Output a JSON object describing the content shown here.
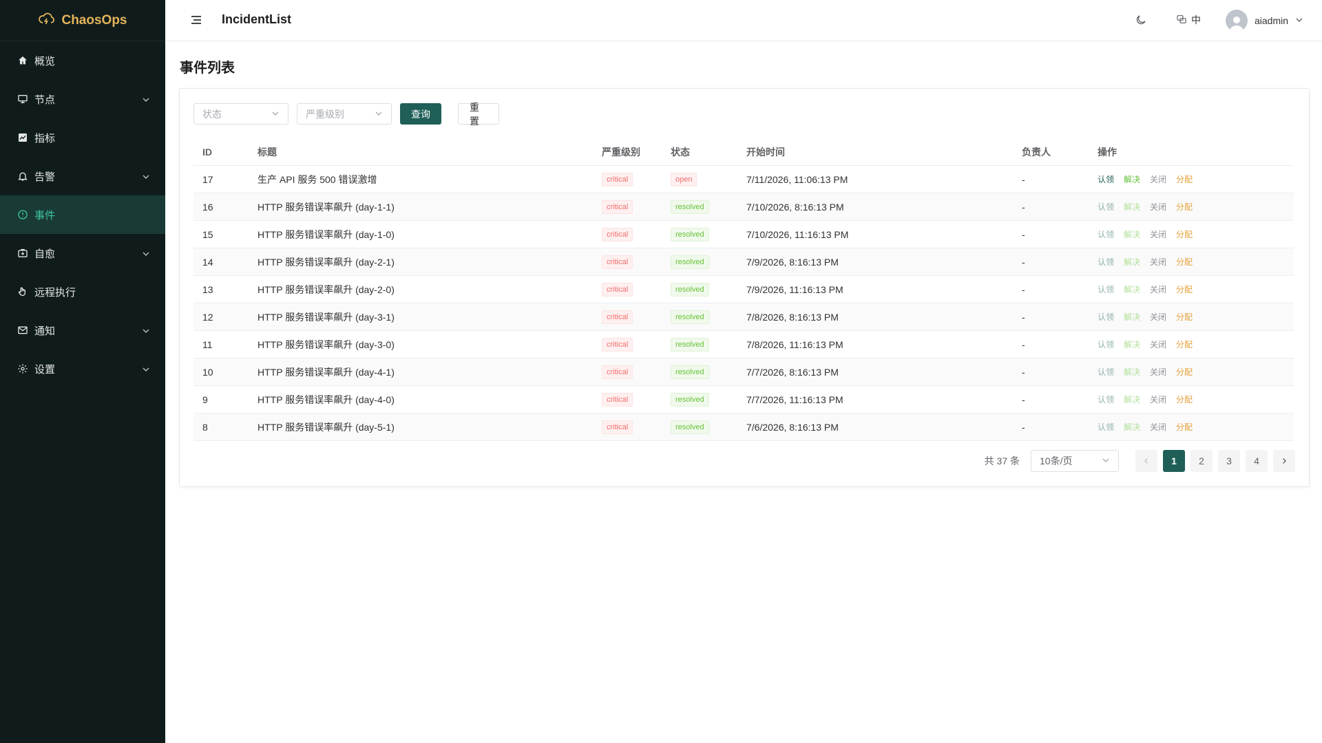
{
  "app": {
    "name": "ChaosOps"
  },
  "sidebar": {
    "items": [
      {
        "label": "概览",
        "icon": "home-icon",
        "has_children": false,
        "active": false
      },
      {
        "label": "节点",
        "icon": "monitor-icon",
        "has_children": true,
        "active": false
      },
      {
        "label": "指标",
        "icon": "chart-icon",
        "has_children": false,
        "active": false
      },
      {
        "label": "告警",
        "icon": "bell-icon",
        "has_children": true,
        "active": false
      },
      {
        "label": "事件",
        "icon": "warning-circle-icon",
        "has_children": false,
        "active": true
      },
      {
        "label": "自愈",
        "icon": "first-aid-icon",
        "has_children": true,
        "active": false
      },
      {
        "label": "远程执行",
        "icon": "hand-icon",
        "has_children": false,
        "active": false
      },
      {
        "label": "通知",
        "icon": "mail-icon",
        "has_children": true,
        "active": false
      },
      {
        "label": "设置",
        "icon": "gear-icon",
        "has_children": true,
        "active": false
      }
    ]
  },
  "header": {
    "title": "IncidentList",
    "lang": "中",
    "username": "aiadmin"
  },
  "page": {
    "title": "事件列表"
  },
  "filters": {
    "status_placeholder": "状态",
    "severity_placeholder": "严重级别",
    "query_label": "查询",
    "reset_label": "重置"
  },
  "table": {
    "columns": [
      "ID",
      "标题",
      "严重级别",
      "状态",
      "开始时间",
      "负责人",
      "操作"
    ],
    "actions": {
      "claim": "认领",
      "resolve": "解决",
      "close": "关闭",
      "assign": "分配"
    },
    "rows": [
      {
        "id": "17",
        "title": "生产 API 服务 500 错误激增",
        "severity": "critical",
        "status": "open",
        "start": "7/11/2026, 11:06:13 PM",
        "owner": "-"
      },
      {
        "id": "16",
        "title": "HTTP 服务错误率飙升 (day-1-1)",
        "severity": "critical",
        "status": "resolved",
        "start": "7/10/2026, 8:16:13 PM",
        "owner": "-"
      },
      {
        "id": "15",
        "title": "HTTP 服务错误率飙升 (day-1-0)",
        "severity": "critical",
        "status": "resolved",
        "start": "7/10/2026, 11:16:13 PM",
        "owner": "-"
      },
      {
        "id": "14",
        "title": "HTTP 服务错误率飙升 (day-2-1)",
        "severity": "critical",
        "status": "resolved",
        "start": "7/9/2026, 8:16:13 PM",
        "owner": "-"
      },
      {
        "id": "13",
        "title": "HTTP 服务错误率飙升 (day-2-0)",
        "severity": "critical",
        "status": "resolved",
        "start": "7/9/2026, 11:16:13 PM",
        "owner": "-"
      },
      {
        "id": "12",
        "title": "HTTP 服务错误率飙升 (day-3-1)",
        "severity": "critical",
        "status": "resolved",
        "start": "7/8/2026, 8:16:13 PM",
        "owner": "-"
      },
      {
        "id": "11",
        "title": "HTTP 服务错误率飙升 (day-3-0)",
        "severity": "critical",
        "status": "resolved",
        "start": "7/8/2026, 11:16:13 PM",
        "owner": "-"
      },
      {
        "id": "10",
        "title": "HTTP 服务错误率飙升 (day-4-1)",
        "severity": "critical",
        "status": "resolved",
        "start": "7/7/2026, 8:16:13 PM",
        "owner": "-"
      },
      {
        "id": "9",
        "title": "HTTP 服务错误率飙升 (day-4-0)",
        "severity": "critical",
        "status": "resolved",
        "start": "7/7/2026, 11:16:13 PM",
        "owner": "-"
      },
      {
        "id": "8",
        "title": "HTTP 服务错误率飙升 (day-5-1)",
        "severity": "critical",
        "status": "resolved",
        "start": "7/6/2026, 8:16:13 PM",
        "owner": "-"
      }
    ]
  },
  "pagination": {
    "total_label": "共 37 条",
    "page_size": "10条/页",
    "pages": [
      "1",
      "2",
      "3",
      "4"
    ],
    "current": "1"
  },
  "colors": {
    "sidebar_bg": "#0f1c1b",
    "brand": "#e5b45a",
    "primary": "#1f5f57",
    "active_nav_text": "#3ec7a1"
  }
}
